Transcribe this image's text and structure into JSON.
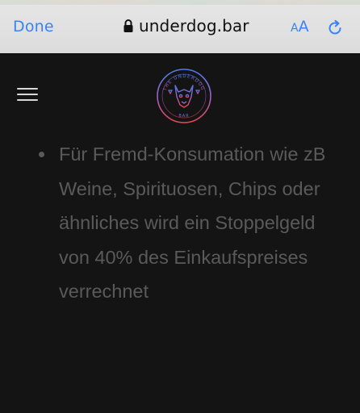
{
  "browser": {
    "done_label": "Done",
    "url": "underdog.bar",
    "aa_small": "A",
    "aa_large": "A",
    "accent_color": "#3b82f6"
  },
  "site": {
    "logo_top_text": "THE UNDERDOG",
    "logo_bottom_text": "BAR",
    "bullets": [
      "Für Fremd-Konsumation wie zB Weine, Spirituosen, Chips oder ähnliches wird ein Stoppelgeld von 40% des Einkaufspreises verrechnet"
    ]
  }
}
